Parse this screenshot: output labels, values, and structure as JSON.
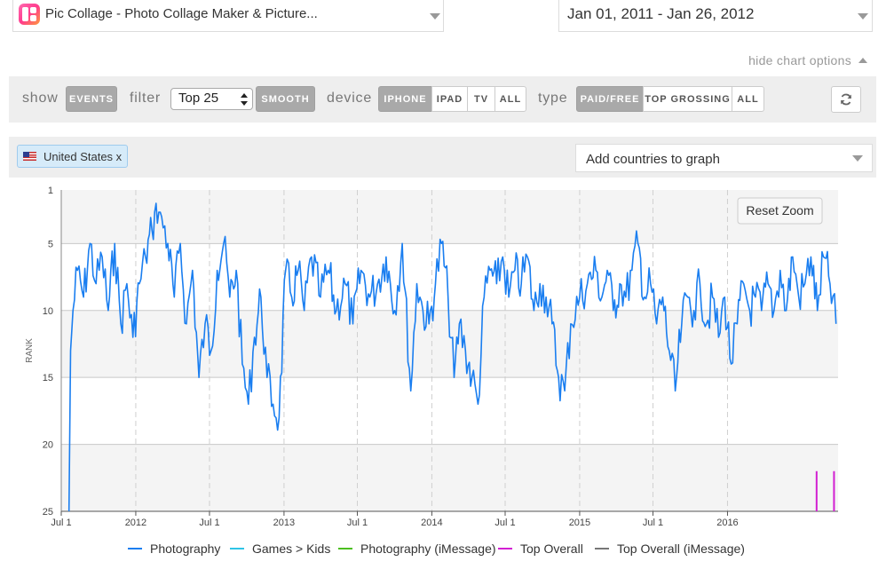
{
  "app_select": {
    "title": "Pic Collage - Photo Collage Maker & Picture..."
  },
  "date_range": {
    "value": "Jan 01, 2011 - Jan 26, 2012"
  },
  "hide_chart_options": "hide chart options",
  "options": {
    "show_label": "show",
    "events_btn": "EVENTS",
    "filter_label": "filter",
    "filter_value": "Top 25",
    "smooth_btn": "SMOOTH",
    "device_label": "device",
    "device_buttons": [
      "IPHONE",
      "IPAD",
      "TV",
      "ALL"
    ],
    "device_active": "IPHONE",
    "type_label": "type",
    "type_buttons": [
      "PAID/FREE",
      "TOP GROSSING",
      "ALL"
    ],
    "type_active": "PAID/FREE"
  },
  "countries": {
    "selected": "United States x",
    "add_placeholder": "Add countries to graph"
  },
  "reset_zoom": "Reset Zoom",
  "colors": {
    "photography": "#1a7ef0",
    "games_kids": "#2ec4e6",
    "photography_imessage": "#4cbf1f",
    "top_overall": "#d21fd2",
    "top_overall_imessage": "#777777"
  },
  "chart_data": {
    "type": "line",
    "ylabel": "RANK",
    "y_reversed": true,
    "ylim": [
      1,
      25
    ],
    "y_ticks": [
      1,
      5,
      10,
      15,
      20,
      25
    ],
    "x_ticks": [
      "Jul 1",
      "2012",
      "Jul 1",
      "2013",
      "Jul 1",
      "2014",
      "Jul 1",
      "2015",
      "Jul 1",
      "2016"
    ],
    "x_tick_dates": [
      "2011-07-01",
      "2012-01-01",
      "2012-07-01",
      "2013-01-01",
      "2013-07-01",
      "2014-01-01",
      "2014-07-01",
      "2015-01-01",
      "2015-07-01",
      "2016-01-01"
    ],
    "xlim": [
      "2011-07-01",
      "2016-09-30"
    ],
    "grid": true,
    "legend_position": "bottom",
    "series": [
      {
        "name": "Photography",
        "color": "#1a7ef0",
        "points": [
          [
            "2011-07-20",
            25
          ],
          [
            "2011-07-24",
            13
          ],
          [
            "2011-07-30",
            10
          ],
          [
            "2011-08-10",
            7
          ],
          [
            "2011-08-25",
            9
          ],
          [
            "2011-09-10",
            5
          ],
          [
            "2011-09-25",
            8
          ],
          [
            "2011-10-10",
            6
          ],
          [
            "2011-10-25",
            10
          ],
          [
            "2011-11-10",
            5
          ],
          [
            "2011-11-25",
            11
          ],
          [
            "2011-12-10",
            8
          ],
          [
            "2011-12-25",
            12
          ],
          [
            "2012-01-10",
            8
          ],
          [
            "2012-01-25",
            6
          ],
          [
            "2012-02-10",
            4
          ],
          [
            "2012-02-20",
            2
          ],
          [
            "2012-03-05",
            3
          ],
          [
            "2012-03-20",
            5
          ],
          [
            "2012-04-05",
            9
          ],
          [
            "2012-04-20",
            5
          ],
          [
            "2012-05-05",
            11
          ],
          [
            "2012-05-20",
            7
          ],
          [
            "2012-06-05",
            15
          ],
          [
            "2012-06-20",
            11
          ],
          [
            "2012-07-05",
            13
          ],
          [
            "2012-07-20",
            7
          ],
          [
            "2012-08-05",
            5
          ],
          [
            "2012-08-20",
            9
          ],
          [
            "2012-09-05",
            7
          ],
          [
            "2012-09-20",
            14
          ],
          [
            "2012-10-05",
            17
          ],
          [
            "2012-10-20",
            12
          ],
          [
            "2012-11-05",
            9
          ],
          [
            "2012-11-20",
            15
          ],
          [
            "2012-12-05",
            17
          ],
          [
            "2012-12-20",
            18
          ],
          [
            "2013-01-05",
            7
          ],
          [
            "2013-01-20",
            9
          ],
          [
            "2013-02-05",
            7
          ],
          [
            "2013-02-20",
            10
          ],
          [
            "2013-03-10",
            6
          ],
          [
            "2013-04-01",
            9
          ],
          [
            "2013-04-20",
            7
          ],
          [
            "2013-05-10",
            10
          ],
          [
            "2013-06-01",
            8
          ],
          [
            "2013-06-20",
            11
          ],
          [
            "2013-07-10",
            7
          ],
          [
            "2013-08-01",
            9
          ],
          [
            "2013-08-20",
            8
          ],
          [
            "2013-09-10",
            6
          ],
          [
            "2013-10-01",
            10
          ],
          [
            "2013-10-20",
            5
          ],
          [
            "2013-11-10",
            16
          ],
          [
            "2013-11-25",
            8
          ],
          [
            "2013-12-10",
            10
          ],
          [
            "2013-12-25",
            11
          ],
          [
            "2014-01-10",
            8
          ],
          [
            "2014-01-25",
            5
          ],
          [
            "2014-02-10",
            9
          ],
          [
            "2014-02-25",
            15
          ],
          [
            "2014-03-10",
            11
          ],
          [
            "2014-03-25",
            13
          ],
          [
            "2014-04-10",
            15
          ],
          [
            "2014-04-25",
            17
          ],
          [
            "2014-05-10",
            9
          ],
          [
            "2014-05-25",
            7
          ],
          [
            "2014-06-10",
            8
          ],
          [
            "2014-06-25",
            6
          ],
          [
            "2014-07-10",
            9
          ],
          [
            "2014-07-25",
            7
          ],
          [
            "2014-08-10",
            8
          ],
          [
            "2014-08-25",
            6
          ],
          [
            "2014-09-10",
            10
          ],
          [
            "2014-09-25",
            8
          ],
          [
            "2014-10-10",
            9
          ],
          [
            "2014-10-25",
            11
          ],
          [
            "2014-11-10",
            15
          ],
          [
            "2014-11-25",
            16
          ],
          [
            "2014-12-10",
            11
          ],
          [
            "2015-01-01",
            9
          ],
          [
            "2015-01-20",
            8
          ],
          [
            "2015-02-10",
            7
          ],
          [
            "2015-02-25",
            9
          ],
          [
            "2015-03-10",
            7
          ],
          [
            "2015-03-25",
            10
          ],
          [
            "2015-04-10",
            8
          ],
          [
            "2015-04-25",
            9
          ],
          [
            "2015-05-10",
            7
          ],
          [
            "2015-05-25",
            5
          ],
          [
            "2015-06-10",
            9
          ],
          [
            "2015-06-25",
            8
          ],
          [
            "2015-07-10",
            11
          ],
          [
            "2015-07-25",
            9
          ],
          [
            "2015-08-10",
            13
          ],
          [
            "2015-08-25",
            16
          ],
          [
            "2015-09-10",
            11
          ],
          [
            "2015-09-25",
            9
          ],
          [
            "2015-10-10",
            10
          ],
          [
            "2015-10-25",
            8
          ],
          [
            "2015-11-10",
            11
          ],
          [
            "2015-11-25",
            9
          ],
          [
            "2015-12-10",
            12
          ],
          [
            "2015-12-25",
            9
          ],
          [
            "2016-01-10",
            14
          ],
          [
            "2016-01-25",
            11
          ],
          [
            "2016-02-10",
            8
          ],
          [
            "2016-02-25",
            10
          ],
          [
            "2016-03-10",
            9
          ],
          [
            "2016-03-25",
            10
          ],
          [
            "2016-04-10",
            8
          ],
          [
            "2016-04-25",
            10
          ],
          [
            "2016-05-10",
            7
          ],
          [
            "2016-05-25",
            10
          ],
          [
            "2016-06-10",
            6
          ],
          [
            "2016-06-25",
            9
          ],
          [
            "2016-07-10",
            8
          ],
          [
            "2016-07-25",
            6
          ],
          [
            "2016-08-10",
            10
          ],
          [
            "2016-08-25",
            6
          ],
          [
            "2016-09-10",
            8
          ],
          [
            "2016-09-25",
            11
          ]
        ]
      },
      {
        "name": "Games > Kids",
        "color": "#2ec4e6",
        "points": []
      },
      {
        "name": "Photography (iMessage)",
        "color": "#4cbf1f",
        "points": []
      },
      {
        "name": "Top Overall",
        "color": "#d21fd2",
        "spikes": [
          [
            "2016-08-08",
            22
          ],
          [
            "2016-09-20",
            22
          ]
        ]
      },
      {
        "name": "Top Overall (iMessage)",
        "color": "#777777",
        "points": []
      }
    ]
  }
}
